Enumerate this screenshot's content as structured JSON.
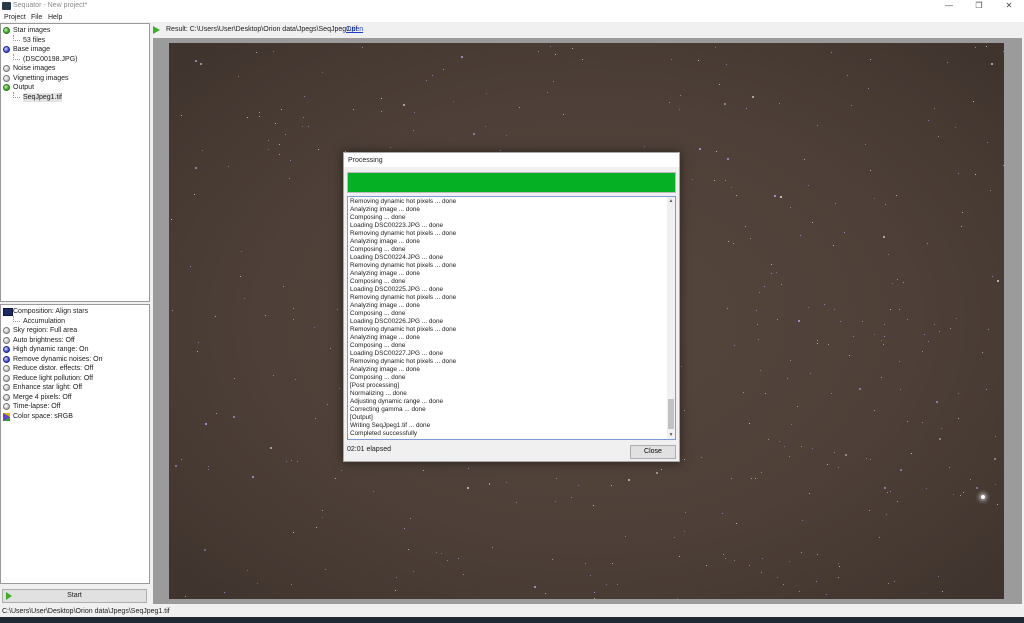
{
  "window": {
    "title": "Sequator - New project*",
    "minimize": "—",
    "maximize": "❐",
    "close": "✕"
  },
  "menu": [
    "Project",
    "File",
    "Help"
  ],
  "tree": [
    {
      "label": "Star images",
      "icon": "green"
    },
    {
      "label": "53 files",
      "child": true
    },
    {
      "label": "Base image",
      "icon": "blue"
    },
    {
      "label": "(DSC00198.JPG)",
      "child": true
    },
    {
      "label": "Noise images",
      "icon": "gray"
    },
    {
      "label": "Vignetting images",
      "icon": "gray"
    },
    {
      "label": "Output",
      "icon": "green"
    },
    {
      "label": "SeqJpeg1.tif",
      "child": true,
      "selected": true
    }
  ],
  "options": [
    {
      "label": "Composition: Align stars",
      "icon": "composition"
    },
    {
      "label": "Accumulation",
      "child": true
    },
    {
      "label": "Sky region: Full area",
      "icon": "gray"
    },
    {
      "label": "Auto brightness: Off",
      "icon": "gray"
    },
    {
      "label": "High dynamic range: On",
      "icon": "blue"
    },
    {
      "label": "Remove dynamic noises: On",
      "icon": "blue"
    },
    {
      "label": "Reduce distor. effects: Off",
      "icon": "gray"
    },
    {
      "label": "Reduce light pollution: Off",
      "icon": "gray"
    },
    {
      "label": "Enhance star light: Off",
      "icon": "gray"
    },
    {
      "label": "Merge 4 pixels: Off",
      "icon": "gray"
    },
    {
      "label": "Time-lapse: Off",
      "icon": "gray"
    },
    {
      "label": "Color space: sRGB",
      "icon": "colorspace"
    }
  ],
  "start_label": "Start",
  "status_path": "C:\\Users\\User\\Desktop\\Orion data\\Jpegs\\SeqJpeg1.tif",
  "result": {
    "text": "Result: C:\\Users\\User\\Desktop\\Orion data\\Jpegs\\SeqJpeg1.tif",
    "open_label": "Open"
  },
  "dialog": {
    "title": "Processing",
    "progress": 1.0,
    "log": [
      "Removing dynamic hot pixels ... done",
      "Analyzing image ... done",
      "Composing ... done",
      "Loading DSC00223.JPG ... done",
      "Removing dynamic hot pixels ... done",
      "Analyzing image ... done",
      "Composing ... done",
      "Loading DSC00224.JPG ... done",
      "Removing dynamic hot pixels ... done",
      "Analyzing image ... done",
      "Composing ... done",
      "Loading DSC00225.JPG ... done",
      "Removing dynamic hot pixels ... done",
      "Analyzing image ... done",
      "Composing ... done",
      "Loading DSC00226.JPG ... done",
      "Removing dynamic hot pixels ... done",
      "Analyzing image ... done",
      "Composing ... done",
      "Loading DSC00227.JPG ... done",
      "Removing dynamic hot pixels ... done",
      "Analyzing image ... done",
      "Composing ... done",
      "[Post processing]",
      "Normalizing ... done",
      "Adjusting dynamic range ... done",
      "Correcting gamma ... done",
      "[Output]",
      "Writing SeqJpeg1.tif ... done",
      "Completed successfully"
    ],
    "elapsed": "02:01 elapsed",
    "close_label": "Close"
  },
  "colors": {
    "progress_fill": "#06b025",
    "link": "#1a3cc8",
    "sky": "#4e4038"
  }
}
